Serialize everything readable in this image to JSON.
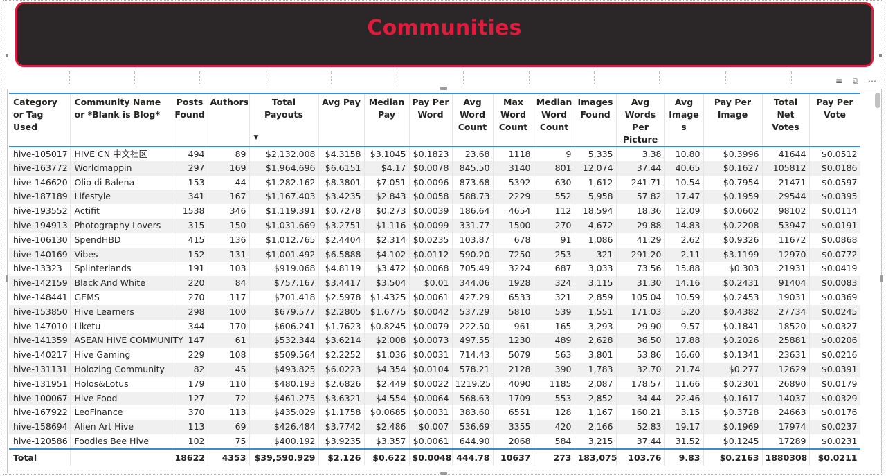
{
  "banner": {
    "title": "Communities"
  },
  "toolbar": {
    "filter_icon": "filter-icon",
    "focus_icon": "focus-mode-icon",
    "more_icon": "more-options-icon"
  },
  "table": {
    "columns": [
      "Category or Tag Used",
      "Community Name or *Blank is Blog*",
      "Posts Found",
      "Authors",
      "Total Payouts",
      "Avg Pay",
      "Median Pay",
      "Pay Per Word",
      "Avg Word Count",
      "Max Word Count",
      "Median Word Count",
      "Images Found",
      "Avg Words Per Picture",
      "Avg Image s",
      "Pay Per Image",
      "Total Net Votes",
      "Pay Per Vote"
    ],
    "sorted_column": "Total Payouts",
    "rows": [
      [
        "hive-105017",
        "HIVE CN 中文社区",
        "494",
        "89",
        "$2,132.008",
        "$4.3158",
        "$3.1045",
        "$0.1823",
        "23.68",
        "1118",
        "9",
        "5,335",
        "3.38",
        "10.80",
        "$0.3996",
        "41644",
        "$0.0512"
      ],
      [
        "hive-163772",
        "Worldmappin",
        "297",
        "169",
        "$1,964.696",
        "$6.6151",
        "$4.17",
        "$0.0078",
        "845.50",
        "3140",
        "801",
        "12,074",
        "37.44",
        "40.65",
        "$0.1627",
        "105812",
        "$0.0186"
      ],
      [
        "hive-146620",
        "Olio di Balena",
        "153",
        "44",
        "$1,282.162",
        "$8.3801",
        "$7.051",
        "$0.0096",
        "873.68",
        "5392",
        "630",
        "1,612",
        "241.71",
        "10.54",
        "$0.7954",
        "21471",
        "$0.0597"
      ],
      [
        "hive-187189",
        "Lifestyle",
        "341",
        "167",
        "$1,167.403",
        "$3.4235",
        "$2.843",
        "$0.0058",
        "588.73",
        "2229",
        "552",
        "5,958",
        "57.82",
        "17.47",
        "$0.1959",
        "29544",
        "$0.0395"
      ],
      [
        "hive-193552",
        "Actifit",
        "1538",
        "346",
        "$1,119.391",
        "$0.7278",
        "$0.273",
        "$0.0039",
        "186.64",
        "4654",
        "112",
        "18,594",
        "18.36",
        "12.09",
        "$0.0602",
        "98102",
        "$0.0114"
      ],
      [
        "hive-194913",
        "Photography Lovers",
        "315",
        "150",
        "$1,031.669",
        "$3.2751",
        "$1.116",
        "$0.0099",
        "331.77",
        "1500",
        "270",
        "4,672",
        "29.88",
        "14.83",
        "$0.2208",
        "53947",
        "$0.0191"
      ],
      [
        "hive-106130",
        "SpendHBD",
        "415",
        "136",
        "$1,012.765",
        "$2.4404",
        "$2.314",
        "$0.0235",
        "103.87",
        "678",
        "91",
        "1,086",
        "41.29",
        "2.62",
        "$0.9326",
        "11672",
        "$0.0868"
      ],
      [
        "hive-140169",
        "Vibes",
        "152",
        "131",
        "$1,001.492",
        "$6.5888",
        "$4.102",
        "$0.0112",
        "590.20",
        "7250",
        "253",
        "321",
        "291.20",
        "2.11",
        "$3.1199",
        "12970",
        "$0.0772"
      ],
      [
        "hive-13323",
        "Splinterlands",
        "191",
        "103",
        "$919.068",
        "$4.8119",
        "$3.472",
        "$0.0068",
        "705.49",
        "3224",
        "687",
        "3,033",
        "73.56",
        "15.88",
        "$0.303",
        "21931",
        "$0.0419"
      ],
      [
        "hive-142159",
        "Black And White",
        "220",
        "84",
        "$757.167",
        "$3.4417",
        "$3.504",
        "$0.01",
        "344.06",
        "1928",
        "324",
        "3,115",
        "31.30",
        "14.16",
        "$0.2431",
        "91404",
        "$0.0083"
      ],
      [
        "hive-148441",
        "GEMS",
        "270",
        "117",
        "$701.418",
        "$2.5978",
        "$1.4325",
        "$0.0061",
        "427.29",
        "6533",
        "321",
        "2,859",
        "105.04",
        "10.59",
        "$0.2453",
        "19031",
        "$0.0369"
      ],
      [
        "hive-153850",
        "Hive Learners",
        "298",
        "100",
        "$679.577",
        "$2.2805",
        "$1.6775",
        "$0.0042",
        "537.29",
        "5810",
        "539",
        "1,551",
        "171.03",
        "5.20",
        "$0.4382",
        "27734",
        "$0.0245"
      ],
      [
        "hive-147010",
        "Liketu",
        "344",
        "170",
        "$606.241",
        "$1.7623",
        "$0.8245",
        "$0.0079",
        "222.50",
        "961",
        "165",
        "3,293",
        "29.90",
        "9.57",
        "$0.1841",
        "18520",
        "$0.0327"
      ],
      [
        "hive-141359",
        "ASEAN HIVE COMMUNITY",
        "147",
        "61",
        "$532.344",
        "$3.6214",
        "$2.008",
        "$0.0073",
        "497.55",
        "1230",
        "489",
        "2,628",
        "36.50",
        "17.88",
        "$0.2026",
        "25881",
        "$0.0206"
      ],
      [
        "hive-140217",
        "Hive Gaming",
        "229",
        "108",
        "$509.564",
        "$2.2252",
        "$1.036",
        "$0.0031",
        "714.43",
        "5079",
        "563",
        "3,801",
        "53.86",
        "16.60",
        "$0.1341",
        "23631",
        "$0.0216"
      ],
      [
        "hive-131131",
        "Holozing Community",
        "82",
        "45",
        "$493.825",
        "$6.0223",
        "$4.354",
        "$0.0104",
        "578.21",
        "2128",
        "390",
        "1,783",
        "32.70",
        "21.74",
        "$0.277",
        "12629",
        "$0.0391"
      ],
      [
        "hive-131951",
        "Holos&Lotus",
        "179",
        "110",
        "$480.193",
        "$2.6826",
        "$2.449",
        "$0.0022",
        "1219.25",
        "4090",
        "1185",
        "2,087",
        "178.57",
        "11.66",
        "$0.2301",
        "26890",
        "$0.0179"
      ],
      [
        "hive-100067",
        "Hive Food",
        "127",
        "72",
        "$461.275",
        "$3.6321",
        "$4.554",
        "$0.0064",
        "568.63",
        "1709",
        "553",
        "2,852",
        "34.44",
        "22.46",
        "$0.1617",
        "14037",
        "$0.0329"
      ],
      [
        "hive-167922",
        "LeoFinance",
        "370",
        "113",
        "$435.029",
        "$1.1758",
        "$0.0685",
        "$0.0031",
        "383.60",
        "6551",
        "128",
        "1,167",
        "160.21",
        "3.15",
        "$0.3728",
        "24663",
        "$0.0176"
      ],
      [
        "hive-158694",
        "Alien Art Hive",
        "113",
        "69",
        "$426.484",
        "$3.7742",
        "$2.486",
        "$0.007",
        "536.69",
        "3355",
        "420",
        "2,166",
        "52.83",
        "19.17",
        "$0.1969",
        "17974",
        "$0.0237"
      ],
      [
        "hive-120586",
        "Foodies Bee Hive",
        "102",
        "75",
        "$400.192",
        "$3.9235",
        "$3.357",
        "$0.0061",
        "644.90",
        "2068",
        "584",
        "3,215",
        "37.44",
        "31.52",
        "$0.1245",
        "17289",
        "$0.0231"
      ]
    ],
    "total": [
      "Total",
      "",
      "18622",
      "4353",
      "$39,590.929",
      "$2.126",
      "$0.622",
      "$0.0048",
      "444.78",
      "10637",
      "273",
      "183,075",
      "103.76",
      "9.83",
      "$0.2163",
      "1880308",
      "$0.0211"
    ]
  }
}
